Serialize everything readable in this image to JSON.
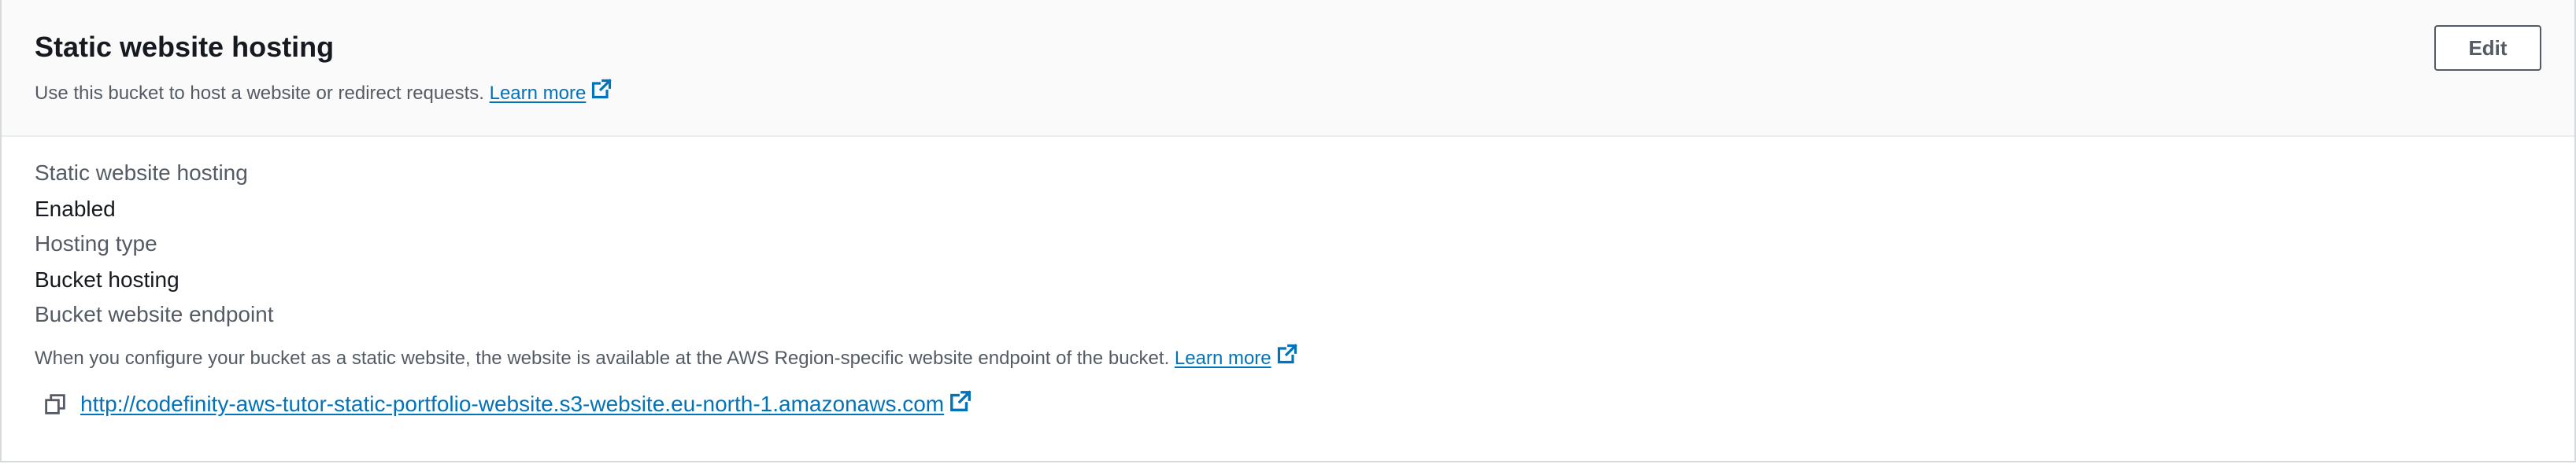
{
  "header": {
    "title": "Static website hosting",
    "description": "Use this bucket to host a website or redirect requests.",
    "learn_more": "Learn more",
    "edit_label": "Edit"
  },
  "fields": {
    "hosting_label": "Static website hosting",
    "hosting_value": "Enabled",
    "type_label": "Hosting type",
    "type_value": "Bucket hosting",
    "endpoint_label": "Bucket website endpoint",
    "endpoint_help": "When you configure your bucket as a static website, the website is available at the AWS Region-specific website endpoint of the bucket.",
    "endpoint_learn_more": "Learn more",
    "endpoint_url": "http://codefinity-aws-tutor-static-portfolio-website.s3-website.eu-north-1.amazonaws.com"
  },
  "icons": {
    "external_link": "external-link-icon",
    "copy": "copy-icon"
  },
  "colors": {
    "link": "#0073bb",
    "header_bg": "#fafafa",
    "label_text": "#545b64",
    "value_text": "#16191f",
    "border": "#d5dbdb"
  }
}
